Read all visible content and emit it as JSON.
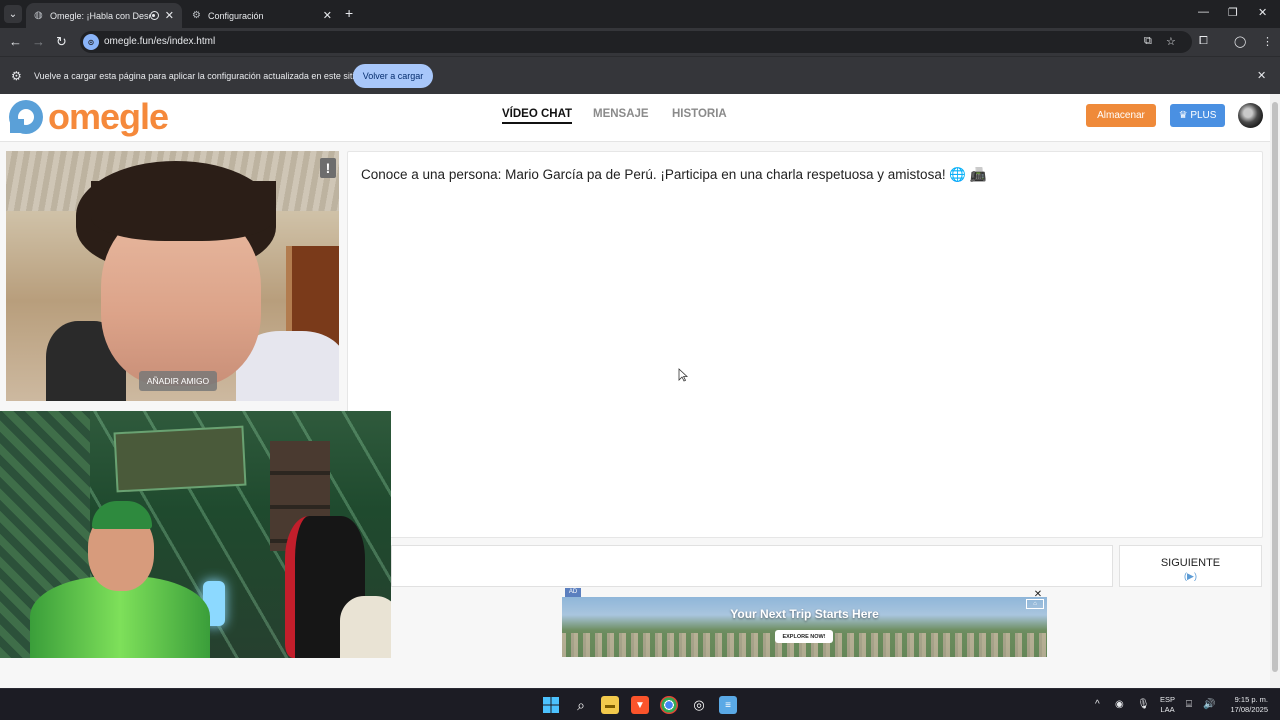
{
  "browser": {
    "tabs": [
      {
        "title": "Omegle: ¡Habla con Descor",
        "active": true
      },
      {
        "title": "Configuración",
        "active": false
      }
    ],
    "url": "omegle.fun/es/index.html",
    "infobar_text": "Vuelve a cargar esta página para aplicar la configuración actualizada en este sitio",
    "infobar_button": "Volver a cargar"
  },
  "site": {
    "logo_text": "omegle",
    "nav": [
      {
        "label": "VÍDEO CHAT",
        "active": true
      },
      {
        "label": "MENSAJE",
        "active": false
      },
      {
        "label": "HISTORIA",
        "active": false
      }
    ],
    "store_button": "Almacenar",
    "plus_button": "PLUS",
    "brand_color": "#f5893b",
    "plus_color": "#4a90e2"
  },
  "stranger_video": {
    "report_symbol": "!",
    "add_friend_button": "AÑADIR AMIGO"
  },
  "chat": {
    "message": "Conoce a una persona: Mario García pa de Perú. ¡Participa en una charla respetuosa y amistosa! 🌐 📠"
  },
  "controls": {
    "next_button": "SIGUIENTE",
    "next_icon": "play-icon"
  },
  "ad": {
    "badge": "AD",
    "title": "Your Next Trip Starts Here",
    "cta": "EXPLORE NOW!"
  },
  "taskbar": {
    "lang_top": "ESP",
    "lang_bottom": "LAA",
    "time": "9:15 p. m.",
    "date": "17/08/2025"
  }
}
